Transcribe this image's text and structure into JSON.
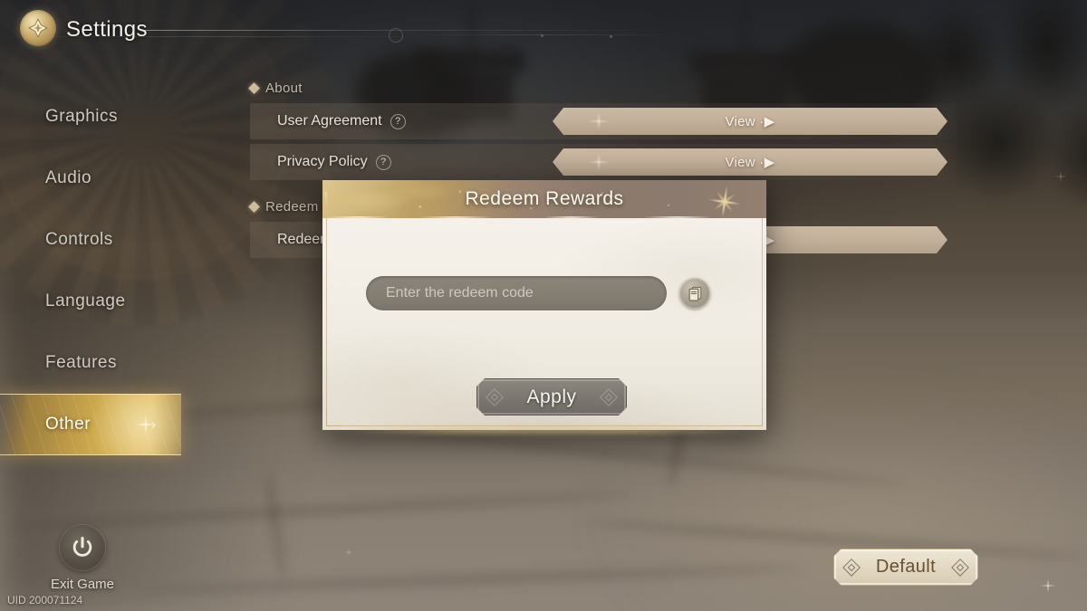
{
  "header": {
    "title": "Settings",
    "emblem_icon": "compass-emblem-icon"
  },
  "sidebar": {
    "items": [
      {
        "label": "Graphics",
        "active": false
      },
      {
        "label": "Audio",
        "active": false
      },
      {
        "label": "Controls",
        "active": false
      },
      {
        "label": "Language",
        "active": false
      },
      {
        "label": "Features",
        "active": false
      },
      {
        "label": "Other",
        "active": true
      }
    ]
  },
  "content": {
    "sections": [
      {
        "title": "About",
        "rows": [
          {
            "label": "User Agreement",
            "help": "?",
            "action": "View ·▶"
          },
          {
            "label": "Privacy Policy",
            "help": "?",
            "action": "View ·▶"
          }
        ]
      },
      {
        "title": "Redeem Code",
        "rows": [
          {
            "label": "Redeem Code",
            "help": "",
            "action": "View ·▶"
          }
        ]
      }
    ]
  },
  "modal": {
    "title": "Redeem Rewards",
    "input_placeholder": "Enter the redeem code",
    "input_value": "",
    "paste_icon": "clipboard-paste-icon",
    "apply_label": "Apply",
    "close_icon": "sparkle-star-icon"
  },
  "footer": {
    "exit_label": "Exit Game",
    "exit_icon": "power-icon",
    "uid": "UID 200071124",
    "default_label": "Default"
  },
  "colors": {
    "accent_gold": "#d6b04e",
    "header_bronze": "#b59a5e",
    "button_tan": "#c3b09a",
    "paper": "#f3efe7",
    "text_light": "#e8e3d9",
    "plaque_cream": "#e4dac5",
    "plaque_text_brown": "#6a4f32"
  }
}
